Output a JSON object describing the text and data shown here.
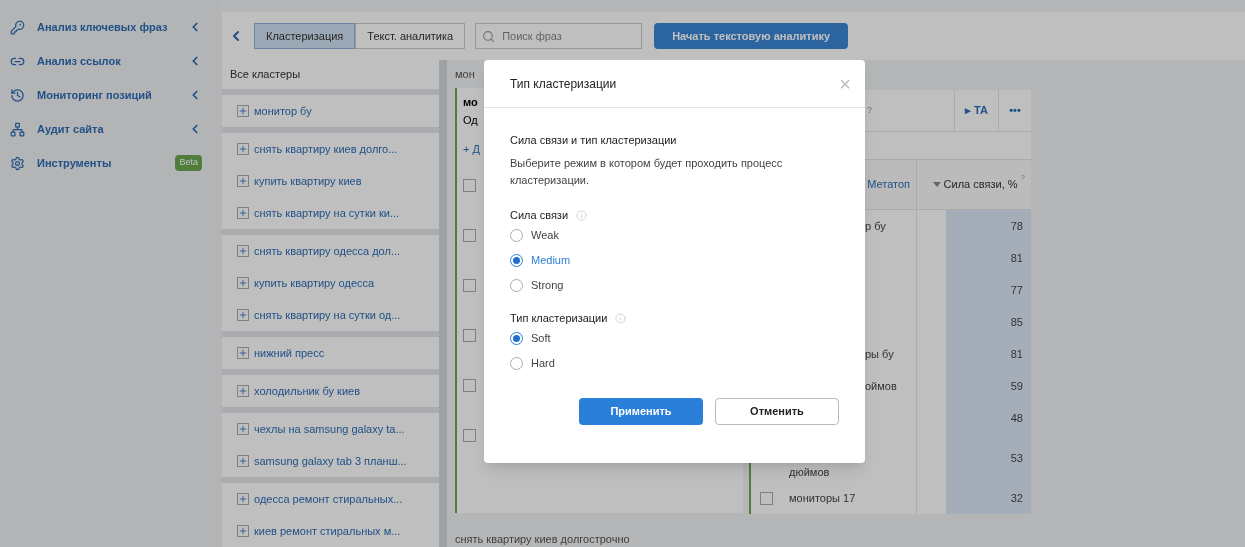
{
  "sidebar": {
    "items": [
      {
        "label": "Анализ ключевых фраз",
        "expandable": true
      },
      {
        "label": "Анализ ссылок",
        "expandable": true
      },
      {
        "label": "Мониторинг позиций",
        "expandable": true
      },
      {
        "label": "Аудит сайта",
        "expandable": true
      },
      {
        "label": "Инструменты",
        "expandable": false,
        "badge": "Beta"
      }
    ]
  },
  "toolbar": {
    "tabs": [
      {
        "label": "Кластеризация",
        "selected": true
      },
      {
        "label": "Текст. аналитика",
        "selected": false
      }
    ],
    "search": {
      "placeholder": "Поиск фраз"
    },
    "start_button": "Начать текстовую аналитику"
  },
  "clusters": {
    "title": "Все кластеры",
    "groups": [
      [
        "монитор бу"
      ],
      [
        "снять квартиру киев долго...",
        "купить квартиру киев",
        "снять квартиру на сутки ки..."
      ],
      [
        "снять квартиру одесса дол...",
        "купить квартиру одесса",
        "снять квартиру на сутки од..."
      ],
      [
        "нижний пресс"
      ],
      [
        "холодильник бу киев"
      ],
      [
        "чехлы на samsung galaxy ta...",
        "samsung galaxy tab 3 планш..."
      ],
      [
        "одесса ремонт стиральных...",
        "киев ремонт стиральных м..."
      ]
    ]
  },
  "middle_panel": {
    "label": "мон",
    "card_title": "мо",
    "card_subtitle": "Од",
    "add_link": "+ Д",
    "rows": [
      {
        "checked": false
      },
      {
        "checked": false
      },
      {
        "checked": false
      },
      {
        "checked": false
      },
      {
        "checked": false
      },
      {
        "checked": false
      }
    ],
    "footer": "снять квартиру киев долгострочно"
  },
  "right_panel": {
    "help": "?",
    "ta_button": "▸ ТА",
    "more": "•••",
    "columns": [
      {
        "label": "Метатоп"
      },
      {
        "label": "Сила связи, %",
        "help": "?"
      }
    ],
    "rows": [
      {
        "kind": "partial",
        "phrase": "р бу",
        "strength": "78"
      },
      {
        "kind": "partial",
        "phrase": "",
        "strength": "81"
      },
      {
        "kind": "partial",
        "phrase": "",
        "strength": "77"
      },
      {
        "kind": "partial",
        "phrase": "",
        "strength": "85"
      },
      {
        "kind": "partial",
        "phrase": "ры бу",
        "strength": "81"
      },
      {
        "kind": "partial",
        "phrase": "оймов",
        "strength": "59"
      },
      {
        "kind": "partial",
        "phrase": "",
        "strength": "48"
      },
      {
        "kind": "tall",
        "phrase": "дюймов",
        "strength": "53"
      },
      {
        "kind": "full",
        "phrase": "мониторы 17",
        "strength": "32",
        "checked": false
      }
    ]
  },
  "dialog": {
    "title": "Тип кластеризации",
    "close": "×",
    "heading": "Сила связи и тип кластеризации",
    "description": "Выберите режим в котором будет проходить процесс кластеризации.",
    "groups": [
      {
        "label": "Сила связи",
        "options": [
          {
            "label": "Weak",
            "selected": false
          },
          {
            "label": "Medium",
            "selected": true
          },
          {
            "label": "Strong",
            "selected": false
          }
        ]
      },
      {
        "label": "Тип кластеризации",
        "options": [
          {
            "label": "Soft",
            "selected": true
          },
          {
            "label": "Hard",
            "selected": false
          }
        ]
      }
    ],
    "apply": "Применить",
    "cancel": "Отменить"
  }
}
